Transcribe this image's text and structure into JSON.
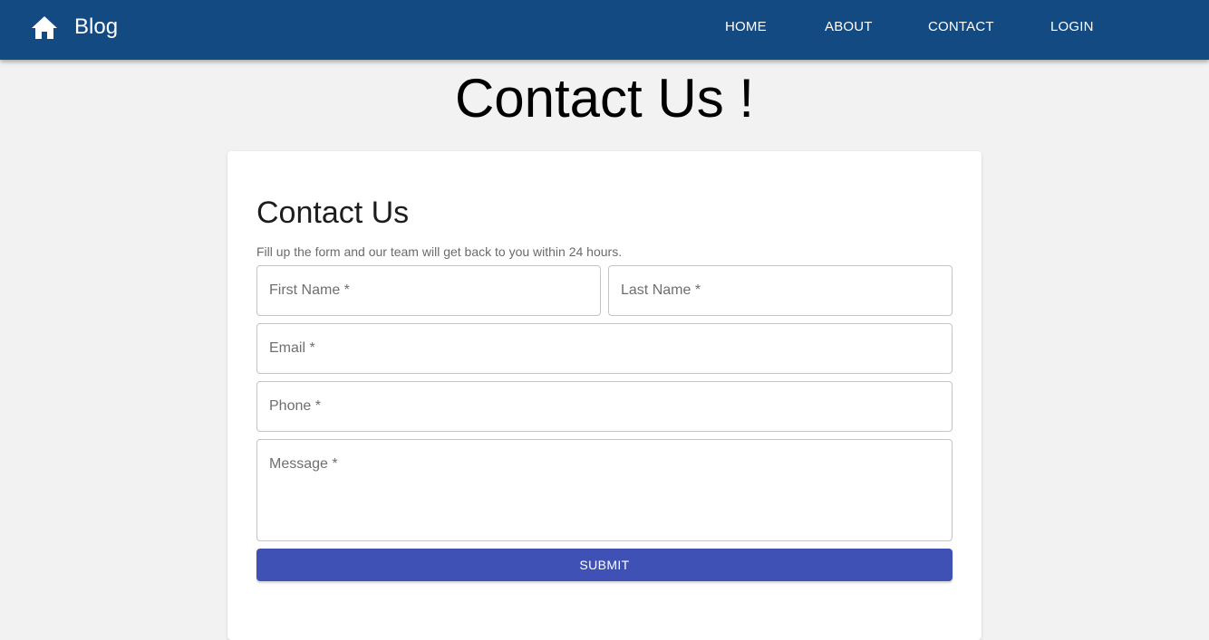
{
  "appbar": {
    "brand": "Blog",
    "icon": "home-icon",
    "background": "#134a82",
    "nav": [
      {
        "label": "HOME"
      },
      {
        "label": "ABOUT"
      },
      {
        "label": "CONTACT"
      },
      {
        "label": "LOGIN"
      }
    ]
  },
  "page": {
    "title": "Contact Us !"
  },
  "form": {
    "title": "Contact Us",
    "subtitle": "Fill up the form and our team will get back to you within 24 hours.",
    "fields": {
      "first_name": {
        "placeholder": "First Name *",
        "value": ""
      },
      "last_name": {
        "placeholder": "Last Name *",
        "value": ""
      },
      "email": {
        "placeholder": "Email *",
        "value": ""
      },
      "phone": {
        "placeholder": "Phone *",
        "value": ""
      },
      "message": {
        "placeholder": "Message *",
        "value": ""
      }
    },
    "submit_label": "SUBMIT",
    "submit_color": "#3f51b5"
  }
}
